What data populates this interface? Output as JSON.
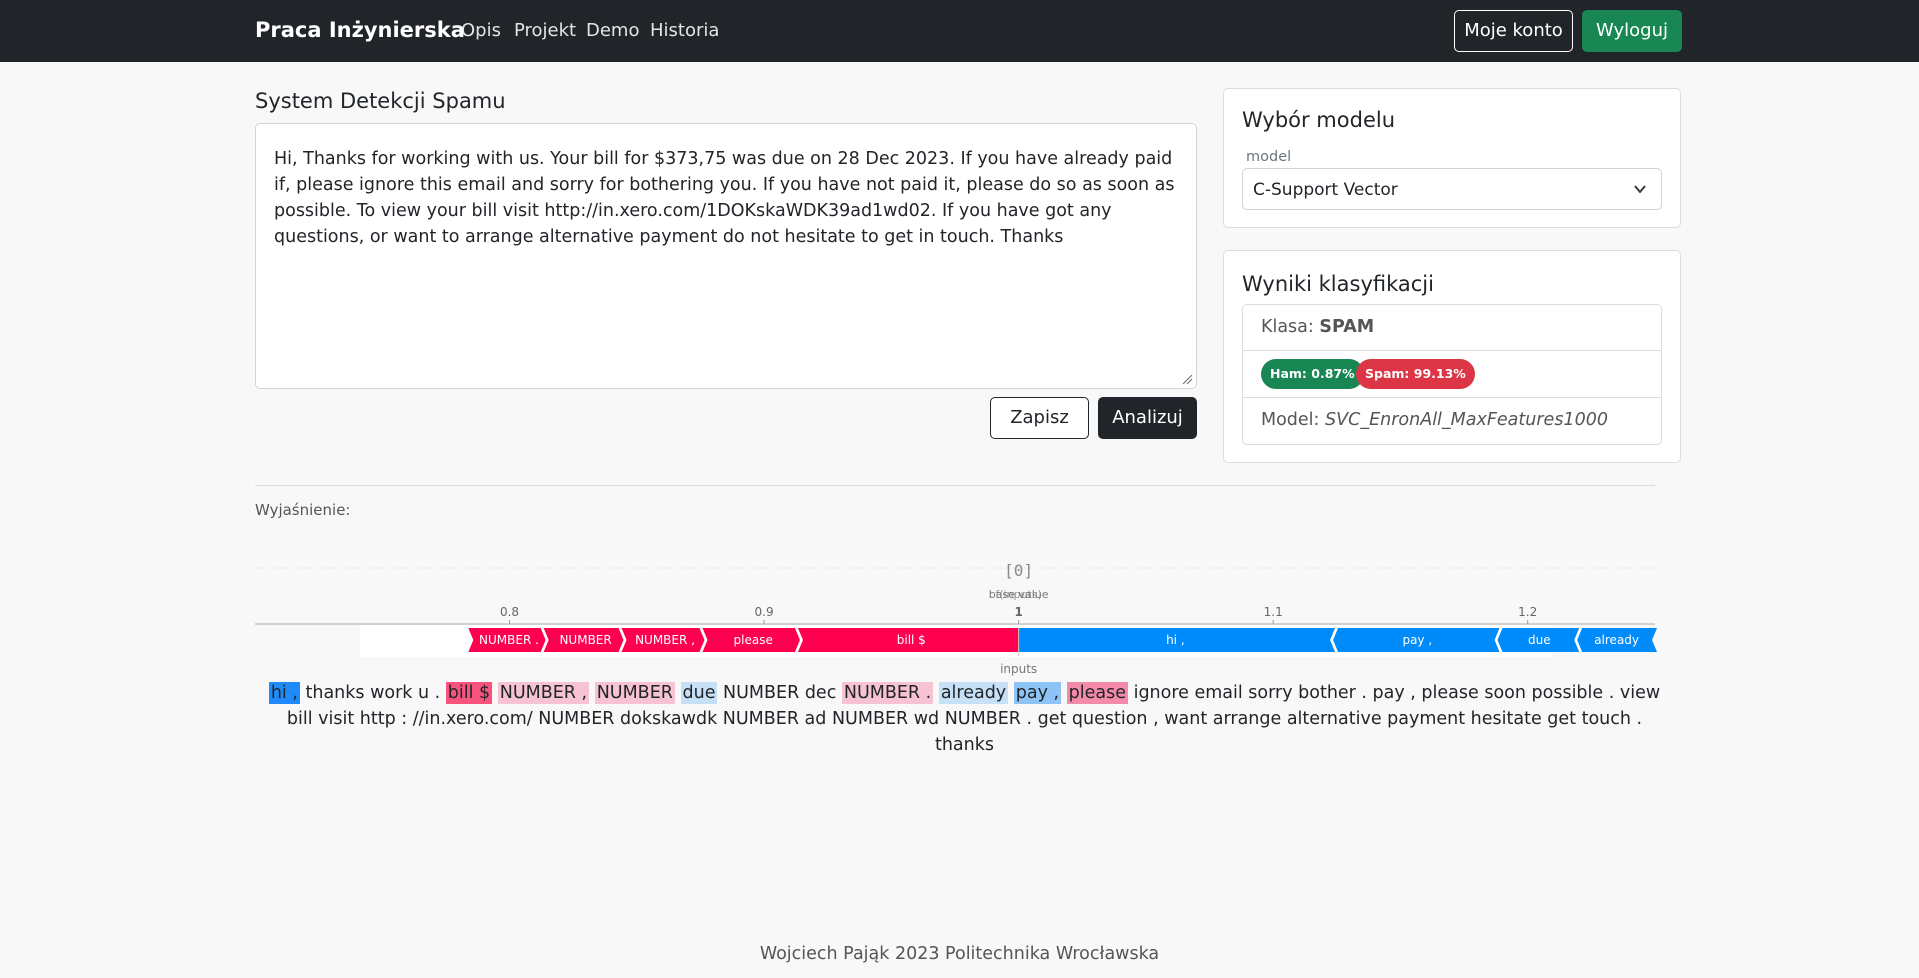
{
  "navbar": {
    "brand": "Praca Inżynierska",
    "links": [
      "Opis",
      "Projekt",
      "Demo",
      "Historia"
    ],
    "account_label": "Moje konto",
    "logout_label": "Wyloguj"
  },
  "main": {
    "title": "System Detekcji Spamu",
    "message": "Hi, Thanks for working with us. Your bill for $373,75 was due on 28 Dec 2023. If you have already paid if, please ignore this email and sorry for bothering you. If you have not paid it, please do so as soon as possible. To view your bill visit http://in.xero.com/1DOKskaWDK39ad1wd02. If you have got any questions, or want to arrange alternative payment do not hesitate to get in touch. Thanks",
    "save_label": "Zapisz",
    "analyze_label": "Analizuj"
  },
  "model_card": {
    "title": "Wybór modelu",
    "field_label": "model",
    "selected": "C-Support Vector"
  },
  "results_card": {
    "title": "Wyniki klasyfikacji",
    "class_label": "Klasa:",
    "class_value": "SPAM",
    "ham_badge": "Ham: 0.87%",
    "spam_badge": "Spam: 99.13%",
    "model_label": "Model:",
    "model_value": "SVC_EnronAll_MaxFeatures1000"
  },
  "explanation": {
    "label": "Wyjaśnienie:",
    "tokens": [
      {
        "text": "hi ,",
        "kind": "neg-strong"
      },
      {
        "text": " thanks work u . ",
        "kind": "none"
      },
      {
        "text": "bill $",
        "kind": "pos-strong"
      },
      {
        "text": " ",
        "kind": "none"
      },
      {
        "text": "NUMBER ,",
        "kind": "pos-light"
      },
      {
        "text": " ",
        "kind": "none"
      },
      {
        "text": "NUMBER",
        "kind": "pos-light"
      },
      {
        "text": " ",
        "kind": "none"
      },
      {
        "text": "due",
        "kind": "neg-light"
      },
      {
        "text": " NUMBER dec ",
        "kind": "none"
      },
      {
        "text": "NUMBER .",
        "kind": "pos-light"
      },
      {
        "text": " ",
        "kind": "none"
      },
      {
        "text": "already",
        "kind": "neg-light"
      },
      {
        "text": " ",
        "kind": "none"
      },
      {
        "text": "pay ,",
        "kind": "neg-mid"
      },
      {
        "text": " ",
        "kind": "none"
      },
      {
        "text": "please",
        "kind": "pos-mid"
      },
      {
        "text": " ignore email sorry bother . pay , please soon possible . view bill visit http : //in.xero.com/ NUMBER dokskawdk NUMBER ad NUMBER wd NUMBER . get question , want arrange alternative payment hesitate get touch . thanks",
        "kind": "none"
      }
    ]
  },
  "chart_data": {
    "type": "force",
    "title": "[0]",
    "base_label": "base value",
    "output_label": "f(inputs)",
    "output_value": "1",
    "xlabel": "inputs",
    "ticks": [
      "0.8",
      "0.9",
      "1",
      "1.1",
      "1.2"
    ],
    "tick_values": [
      0.8,
      0.9,
      1.0,
      1.1,
      1.2
    ],
    "output_at": 1.0,
    "view_range": [
      0.7,
      1.25
    ],
    "positive": [
      {
        "label": "NUMBER .",
        "from": 0.7838,
        "to": 0.8134
      },
      {
        "label": "NUMBER",
        "from": 0.8134,
        "to": 0.844
      },
      {
        "label": "NUMBER ,",
        "from": 0.844,
        "to": 0.8758
      },
      {
        "label": "please",
        "from": 0.8758,
        "to": 0.9133
      },
      {
        "label": "bill $",
        "from": 0.9133,
        "to": 1.0
      }
    ],
    "negative": [
      {
        "label": "hi ,",
        "from": 1.0,
        "to": 1.1255
      },
      {
        "label": "pay ,",
        "from": 1.1255,
        "to": 1.1901
      },
      {
        "label": "due",
        "from": 1.1901,
        "to": 1.2214
      },
      {
        "label": "already",
        "from": 1.2214,
        "to": 1.2508
      }
    ],
    "colors": {
      "positive": "#ff0051",
      "negative": "#008bfb"
    }
  },
  "footer": {
    "text": "Wojciech Pająk 2023 Politechnika Wrocławska"
  }
}
